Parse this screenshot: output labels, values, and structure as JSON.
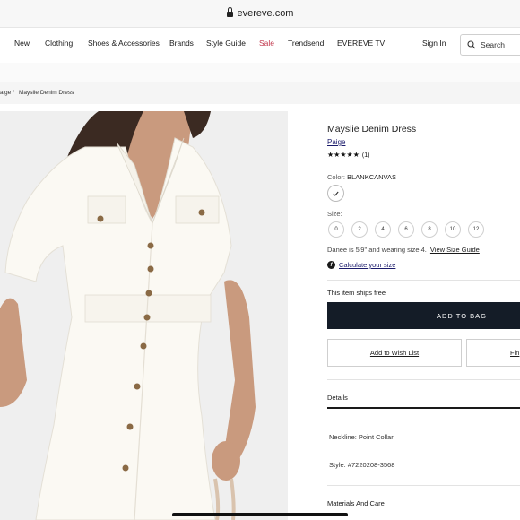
{
  "browser": {
    "url": "evereve.com"
  },
  "nav": {
    "items": [
      "New",
      "Clothing",
      "Shoes & Accessories",
      "Brands",
      "Style Guide",
      "Sale",
      "Trendsend",
      "EVEREVE TV"
    ],
    "sign_in": "Sign In",
    "search_placeholder": "Search"
  },
  "breadcrumb": {
    "parent": "aige",
    "separator": "/",
    "current": "Mayslie Denim Dress"
  },
  "product": {
    "title": "Mayslie Denim Dress",
    "brand": "Paige",
    "stars": "★★★★★",
    "review_count": "(1)",
    "rating": 5,
    "color_label": "Color:",
    "color_value": "BLANKCANVAS",
    "size_label": "Size:",
    "sizes": [
      "0",
      "2",
      "4",
      "6",
      "8",
      "10",
      "12"
    ],
    "model_note": "Danee is 5'9\" and wearing size 4.",
    "size_guide_link": "View Size Guide",
    "calculate_size_link": "Calculate your size",
    "ships_note": "This item ships free",
    "add_to_bag": "ADD TO BAG",
    "add_to_wishlist": "Add to Wish List",
    "find_in_store": "Fin"
  },
  "details": {
    "heading": "Details",
    "neckline": "Neckline: Point Collar",
    "style": "Style: #7220208-3568",
    "materials_heading": "Materials And Care"
  },
  "colors": {
    "sale": "#c0354a",
    "primary_button": "#141c27",
    "link": "#1a1a6b"
  }
}
